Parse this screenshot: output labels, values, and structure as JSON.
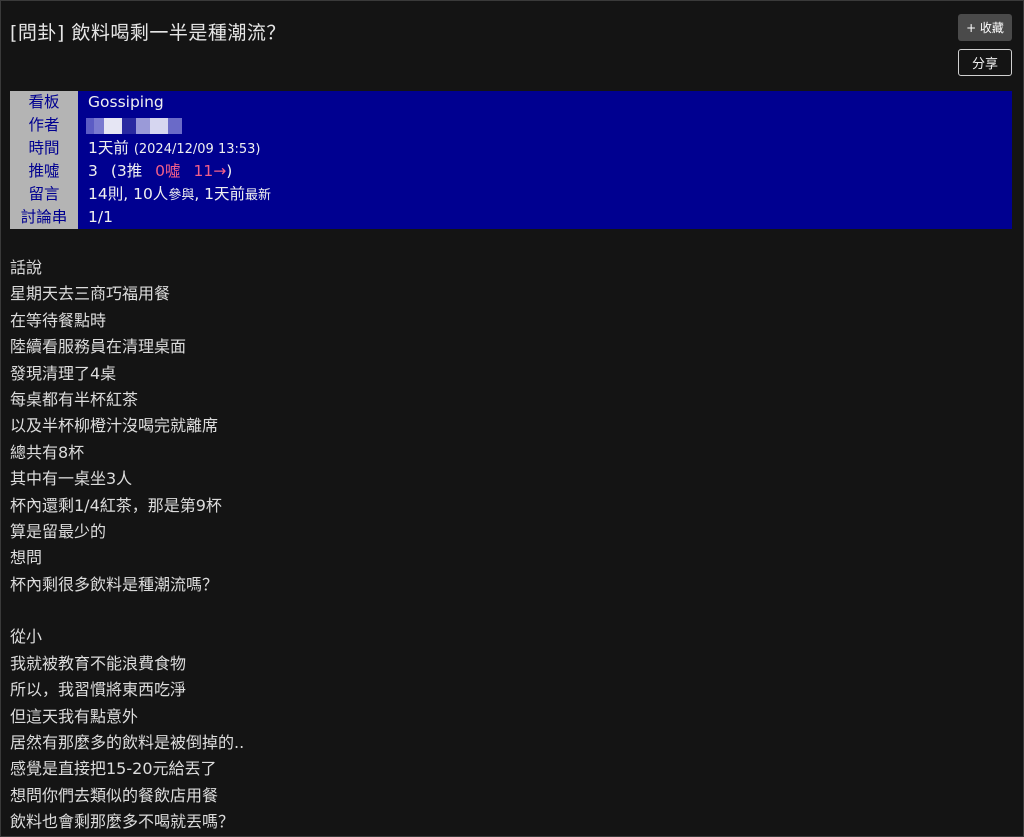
{
  "header": {
    "title": "[問卦] 飲料喝剩一半是種潮流？",
    "fav_button": "+ 收藏",
    "share_button": "分享"
  },
  "meta": {
    "board_label": "看板",
    "board_value": "Gossiping",
    "author_label": "作者",
    "time_label": "時間",
    "time_relative": "1天前",
    "time_absolute": "(2024/12/09 13:53)",
    "push_label": "推噓",
    "push_total": "3",
    "push_open": "(3推",
    "boo_count": "0噓",
    "arrow_count": "11→",
    "push_close": ")",
    "comment_label": "留言",
    "comment_count": "14則, 10人",
    "comment_participate": "參與",
    "comment_sep": ", 1天前",
    "comment_latest": "最新",
    "thread_label": "討論串",
    "thread_value": "1/1"
  },
  "content": {
    "lines": [
      "話說",
      "星期天去三商巧福用餐",
      "在等待餐點時",
      "陸續看服務員在清理桌面",
      "發現清理了4桌",
      "每桌都有半杯紅茶",
      "以及半杯柳橙汁沒喝完就離席",
      "總共有8杯",
      "其中有一桌坐3人",
      "杯內還剩1/4紅茶，那是第9杯",
      "算是留最少的",
      "想問",
      "杯內剩很多飲料是種潮流嗎？",
      "",
      "從小",
      "我就被教育不能浪費食物",
      "所以，我習慣將東西吃淨",
      "但這天我有點意外",
      "居然有那麼多的飲料是被倒掉的..",
      "感覺是直接把15-20元給丟了",
      "想問你們去類似的餐飲店用餐",
      "飲料也會剩那麼多不喝就丟嗎？"
    ]
  },
  "colors": {
    "background": "#141414",
    "meta_background": "#000090",
    "meta_label_background": "#b4b4b4",
    "boo_arrow_color": "#f25f8a"
  }
}
